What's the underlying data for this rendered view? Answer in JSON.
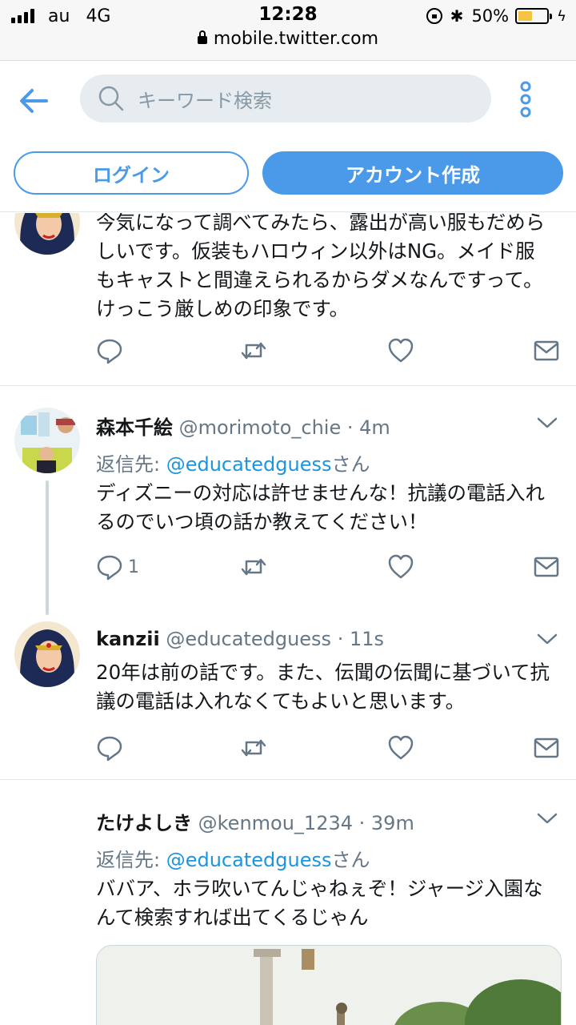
{
  "status_bar": {
    "carrier": "au",
    "network": "4G",
    "time": "12:28",
    "battery": "50%",
    "battery_level": 0.5,
    "url": "mobile.twitter.com"
  },
  "header": {
    "search_placeholder": "キーワード検索",
    "login_label": "ログイン",
    "signup_label": "アカウント作成"
  },
  "colors": {
    "accent": "#4a9ae9",
    "link": "#1b95e0",
    "muted": "#657786"
  },
  "tweets": [
    {
      "text": "今気になって調べてみたら、露出が高い服もだめらしいです。仮装もハロウィン以外はNG。メイド服もキャストと間違えられるからダメなんですって。けっこう厳しめの印象です。",
      "reply_count": ""
    },
    {
      "name": "森本千絵",
      "handle": "@morimoto_chie",
      "time": "· 4m",
      "reply_prefix": "返信先: ",
      "reply_user": "@educatedguess",
      "reply_suffix": "さん",
      "text": "ディズニーの対応は許せませんな！抗議の電話入れるのでいつ頃の話か教えてください！",
      "reply_count": "1"
    },
    {
      "name": "kanzii",
      "handle": "@educatedguess",
      "time": "· 11s",
      "text": "20年は前の話です。また、伝聞の伝聞に基づいて抗議の電話は入れなくてもよいと思います。",
      "reply_count": ""
    },
    {
      "name": "たけよしき",
      "handle": "@kenmou_1234",
      "time": "· 39m",
      "reply_prefix": "返信先: ",
      "reply_user": "@educatedguess",
      "reply_suffix": "さん",
      "text": "ババア、ホラ吹いてんじゃねぇぞ！ジャージ入園なんて検索すれば出てくるじゃん"
    }
  ],
  "icons": [
    "back-arrow-icon",
    "search-icon",
    "more-vertical-icon",
    "reply-icon",
    "retweet-icon",
    "like-icon",
    "direct-message-icon",
    "chevron-down-icon"
  ]
}
